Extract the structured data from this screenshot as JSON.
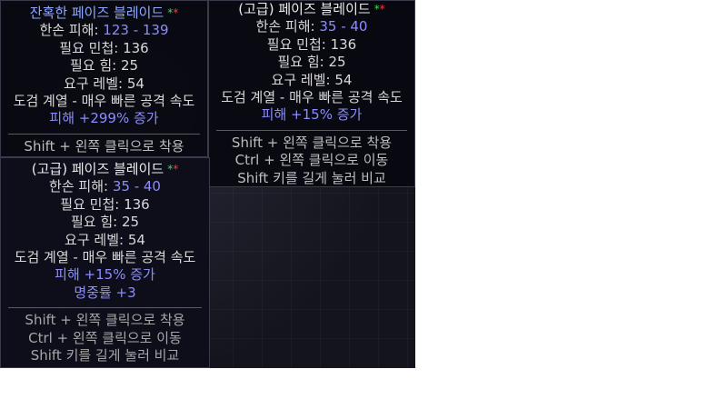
{
  "tooltip1": {
    "name": "잔혹한 페이즈 블레이드",
    "stars": [
      "*",
      "*"
    ],
    "damage_label": "한손 피해:",
    "damage_value": "123 - 139",
    "req_dex": "필요 민첩: 136",
    "req_str": "필요 힘: 25",
    "req_level": "요구 레벨: 54",
    "type_line": "도검 계열 - 매우 빠른 공격 속도",
    "mod1": "피해 +299% 증가",
    "help1": "Shift + 왼쪽 클릭으로 착용"
  },
  "tooltip2": {
    "name": "(고급) 페이즈 블레이드",
    "stars": [
      "*",
      "*"
    ],
    "damage_label": "한손 피해:",
    "damage_value": "35 - 40",
    "req_dex": "필요 민첩: 136",
    "req_str": "필요 힘: 25",
    "req_level": "요구 레벨: 54",
    "type_line": "도검 계열 - 매우 빠른 공격 속도",
    "mod1": "피해 +15% 증가",
    "help1": "Shift + 왼쪽 클릭으로 착용",
    "help2": "Ctrl + 왼쪽 클릭으로 이동",
    "help3": "Shift 키를 길게 눌러 비교"
  },
  "tooltip3": {
    "name": "(고급) 페이즈 블레이드",
    "stars": [
      "*",
      "*"
    ],
    "damage_label": "한손 피해:",
    "damage_value": "35 - 40",
    "req_dex": "필요 민첩: 136",
    "req_str": "필요 힘: 25",
    "req_level": "요구 레벨: 54",
    "type_line": "도검 계열 - 매우 빠른 공격 속도",
    "mod1": "피해 +15% 증가",
    "mod2": "명중률 +3",
    "help1": "Shift + 왼쪽 클릭으로 착용",
    "help2": "Ctrl + 왼쪽 클릭으로 이동",
    "help3": "Shift 키를 길게 눌러 비교"
  },
  "colors": {
    "rare_name": "#8fa8ff",
    "magic_blue": "#8c8cff",
    "star_green": "#3ddc5a",
    "star_red": "#ff3a3a"
  }
}
